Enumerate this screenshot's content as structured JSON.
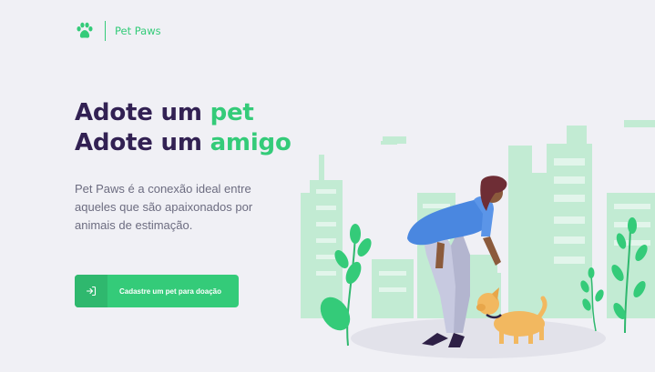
{
  "brand": {
    "name": "Pet Paws",
    "icon": "paw-icon"
  },
  "hero": {
    "title_line1_prefix": "Adote um",
    "title_line1_highlight": "pet",
    "title_line2_prefix": "Adote um",
    "title_line2_highlight": "amigo",
    "description": "Pet Paws é a conexão ideal entre aqueles que são apaixonados por animais de estimação."
  },
  "cta": {
    "label": "Cadastre um pet para doação",
    "icon": "sign-in-icon"
  },
  "illustration": {
    "subject": "woman-petting-dog-icon"
  },
  "colors": {
    "background": "#f0f0f5",
    "primary": "#34cb79",
    "primary_dark": "#2fb86e",
    "title": "#322153",
    "text": "#6c6c80",
    "buildings": "#c2ebd3"
  }
}
